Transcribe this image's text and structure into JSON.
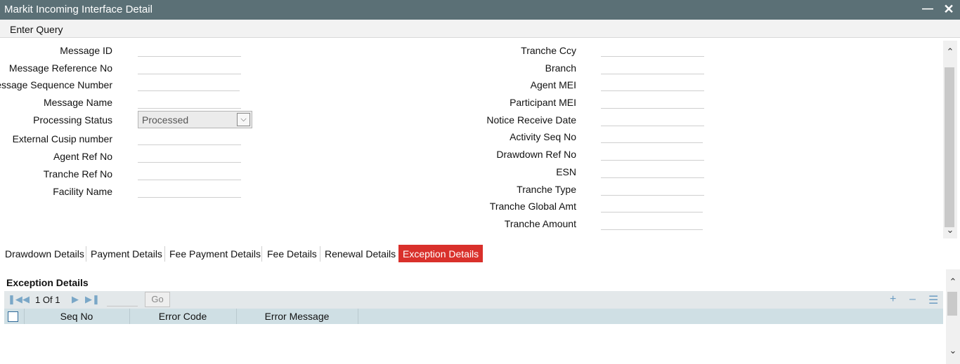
{
  "window": {
    "title": "Markit Incoming Interface Detail"
  },
  "toolbar": {
    "enter_query": "Enter Query"
  },
  "form": {
    "left_labels": {
      "message_id": "Message ID",
      "message_reference_no": "Message Reference No",
      "message_sequence_number": "Message Sequence Number",
      "message_name": "Message Name",
      "processing_status": "Processing Status",
      "external_cusip_number": "External Cusip number",
      "agent_ref_no": "Agent Ref No",
      "tranche_ref_no": "Tranche Ref No",
      "facility_name": "Facility Name"
    },
    "right_labels": {
      "tranche_ccy": "Tranche Ccy",
      "branch": "Branch",
      "agent_mei": "Agent MEI",
      "participant_mei": "Participant MEI",
      "notice_receive_date": "Notice Receive Date",
      "activity_seq_no": "Activity Seq No",
      "drawdown_ref_no": "Drawdown Ref No",
      "esn": "ESN",
      "tranche_type": "Tranche Type",
      "tranche_global_amt": "Tranche Global Amt",
      "tranche_amount": "Tranche Amount"
    },
    "processing_status_value": "Processed"
  },
  "tabs": {
    "drawdown": "Drawdown Details",
    "payment": "Payment Details",
    "fee_payment": "Fee Payment Details",
    "fee": "Fee Details",
    "renewal": "Renewal Details",
    "exception": "Exception Details",
    "active": "Exception Details"
  },
  "exception": {
    "section_title": "Exception Details",
    "pagination": {
      "current": "1",
      "of_label": "Of",
      "total": "1",
      "go_label": "Go"
    },
    "columns": {
      "seq_no": "Seq No",
      "error_code": "Error Code",
      "error_message": "Error Message"
    }
  },
  "colors": {
    "titlebar": "#5b7076",
    "active_tab": "#d9302b",
    "grid_header": "#cfdfe4",
    "grid_toolbar": "#e3e8ea"
  }
}
